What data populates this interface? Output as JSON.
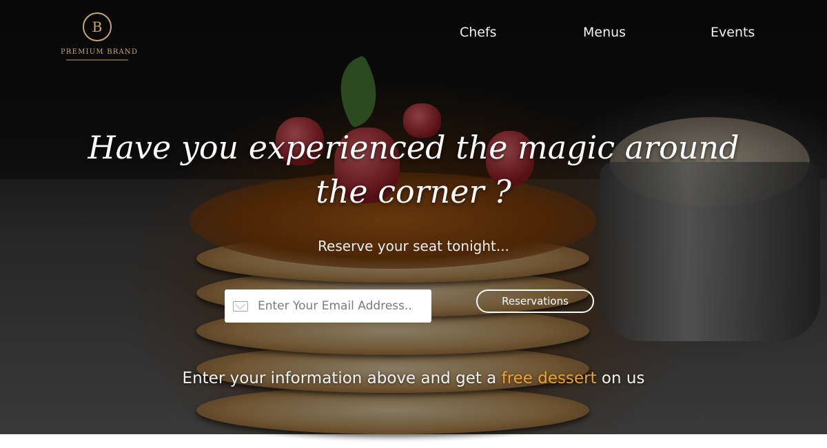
{
  "logo": {
    "monogram": "B",
    "brand": "PREMIUM BRAND"
  },
  "nav": {
    "items": [
      "Chefs",
      "Menus",
      "Events"
    ]
  },
  "hero": {
    "headline": "Have you experienced the magic around the corner ?",
    "subline": "Reserve your seat tonight..."
  },
  "form": {
    "email_placeholder": "Enter Your Email Address..",
    "button_label": "Reservations"
  },
  "promo": {
    "before": "Enter your information above and get a ",
    "highlight": "free dessert",
    "after": " on us"
  },
  "colors": {
    "accent": "#f0a22e",
    "logo_gold": "#c8a96a",
    "text": "#ffffff"
  },
  "icons": {
    "email": "envelope-icon"
  }
}
